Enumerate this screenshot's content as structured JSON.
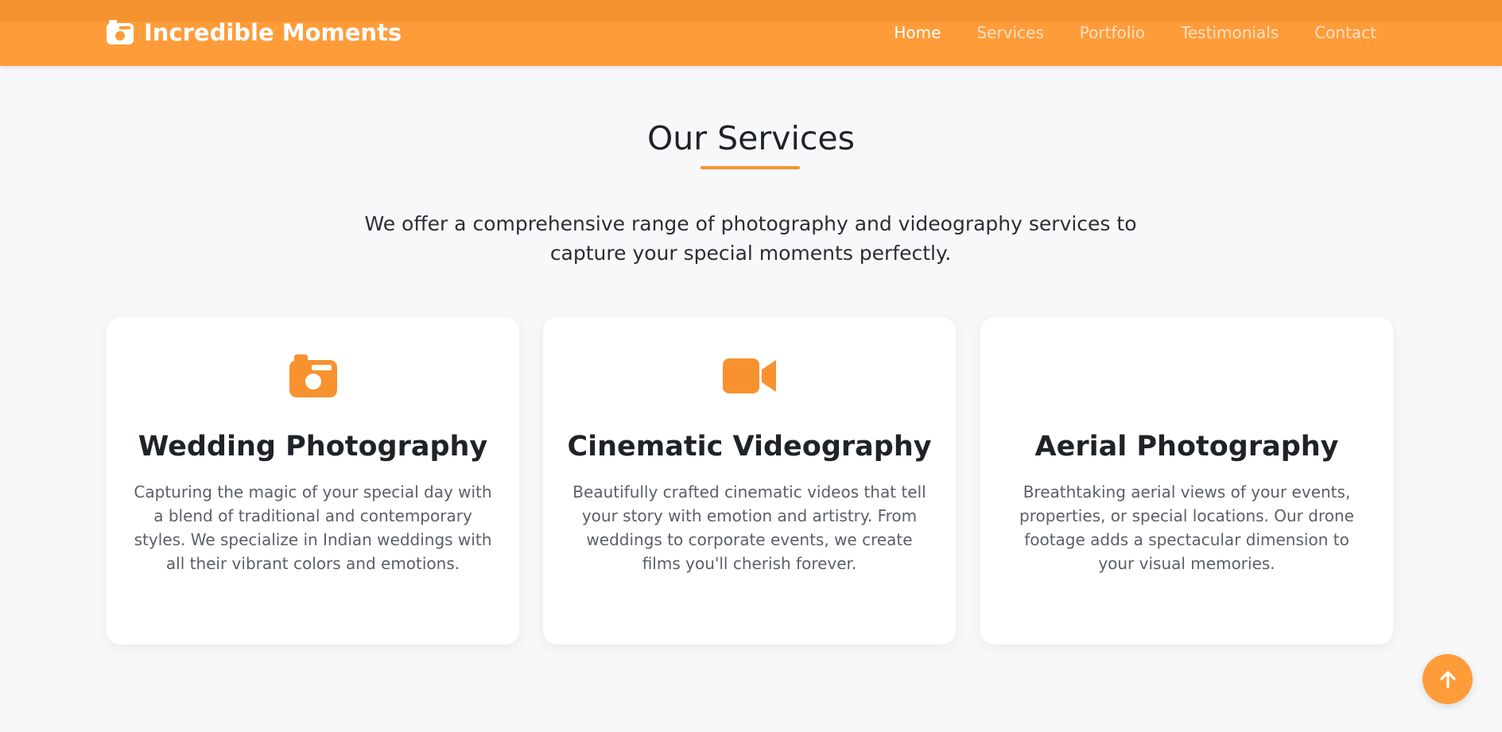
{
  "brand": {
    "name": "Incredible Moments",
    "icon": "camera-icon"
  },
  "nav": {
    "items": [
      "Home",
      "Services",
      "Portfolio",
      "Testimonials",
      "Contact"
    ],
    "active": "Home"
  },
  "services": {
    "title": "Our Services",
    "intro": "We offer a comprehensive range of photography and videography services to capture your special moments perfectly.",
    "cards": [
      {
        "icon": "camera-icon",
        "title": "Wedding Photography",
        "description": "Capturing the magic of your special day with a blend of traditional and contemporary styles. We specialize in Indian weddings with all their vibrant colors and emotions."
      },
      {
        "icon": "video-camera-icon",
        "title": "Cinematic Videography",
        "description": "Beautifully crafted cinematic videos that tell your story with emotion and artistry. From weddings to corporate events, we create films you'll cherish forever."
      },
      {
        "icon": "",
        "title": "Aerial Photography",
        "description": "Breathtaking aerial views of your events, properties, or special locations. Our drone footage adds a spectacular dimension to your visual memories."
      }
    ]
  },
  "colors": {
    "accent": "#ff9c3a",
    "accent_dark": "#f59230",
    "background": "#f7f8fa"
  },
  "scroll_to_top": {
    "icon": "arrow-up-icon"
  }
}
